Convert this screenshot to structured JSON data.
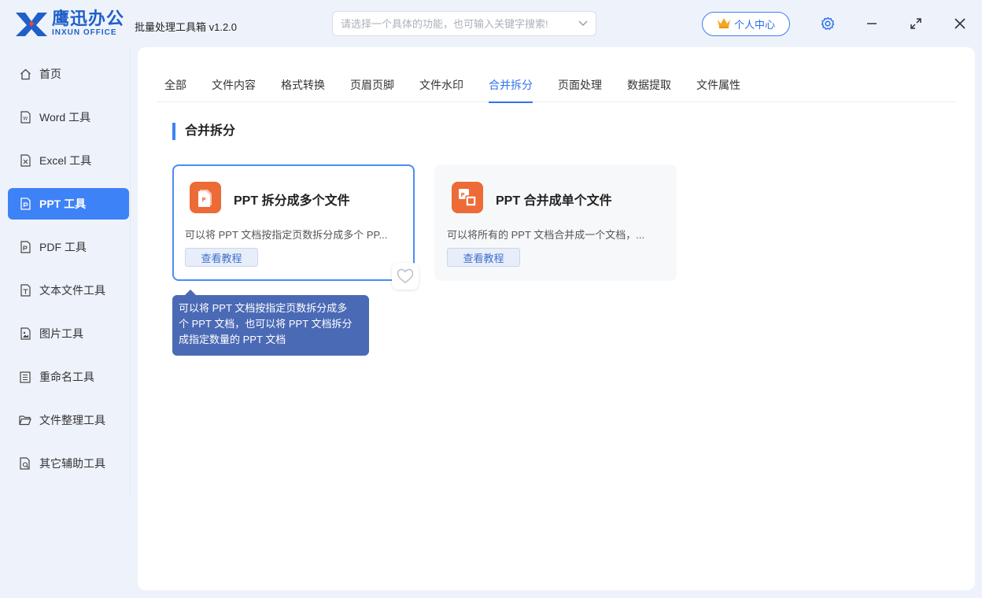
{
  "app": {
    "logo_cn": "鹰迅办公",
    "logo_en": "INXUN OFFICE",
    "title": "批量处理工具箱 v1.2.0"
  },
  "search": {
    "placeholder": "请选择一个具体的功能，也可输入关键字搜索!",
    "value": ""
  },
  "header": {
    "user_center_label": "个人中心",
    "settings_icon": "gear-icon",
    "minimize_icon": "minimize-icon",
    "maximize_icon": "maximize-icon",
    "close_icon": "close-icon"
  },
  "sidebar": {
    "items": [
      {
        "label": "首页",
        "icon": "home-icon"
      },
      {
        "label": "Word 工具",
        "icon": "word-file-icon"
      },
      {
        "label": "Excel 工具",
        "icon": "excel-file-icon"
      },
      {
        "label": "PPT 工具",
        "icon": "ppt-file-icon",
        "active": true
      },
      {
        "label": "PDF 工具",
        "icon": "pdf-file-icon"
      },
      {
        "label": "文本文件工具",
        "icon": "text-file-icon"
      },
      {
        "label": "图片工具",
        "icon": "image-file-icon"
      },
      {
        "label": "重命名工具",
        "icon": "rename-icon"
      },
      {
        "label": "文件整理工具",
        "icon": "folder-icon"
      },
      {
        "label": "其它辅助工具",
        "icon": "tools-icon"
      }
    ]
  },
  "tabs": [
    {
      "label": "全部"
    },
    {
      "label": "文件内容"
    },
    {
      "label": "格式转换"
    },
    {
      "label": "页眉页脚"
    },
    {
      "label": "文件水印"
    },
    {
      "label": "合并拆分",
      "active": true
    },
    {
      "label": "页面处理"
    },
    {
      "label": "数据提取"
    },
    {
      "label": "文件属性"
    }
  ],
  "section": {
    "title": "合并拆分"
  },
  "cards": [
    {
      "title": "PPT 拆分成多个文件",
      "description": "可以将 PPT 文档按指定页数拆分成多个 PP...",
      "button_label": "查看教程",
      "icon": "ppt-split-icon",
      "selected": true
    },
    {
      "title": "PPT 合并成单个文件",
      "description": "可以将所有的 PPT 文档合并成一个文档，...",
      "button_label": "查看教程",
      "icon": "ppt-merge-icon",
      "selected": false
    }
  ],
  "tooltip": {
    "line1": "可以将 PPT 文档按指定页数拆分成多",
    "line2": "个 PPT 文档，也可以将 PPT 文档拆分",
    "line3": "成指定数量的 PPT 文档"
  },
  "colors": {
    "accent": "#3e82f7",
    "brand": "#1f5fc8",
    "ppt_orange": "#ec6b37",
    "tooltip_bg": "#4b6ab5"
  }
}
